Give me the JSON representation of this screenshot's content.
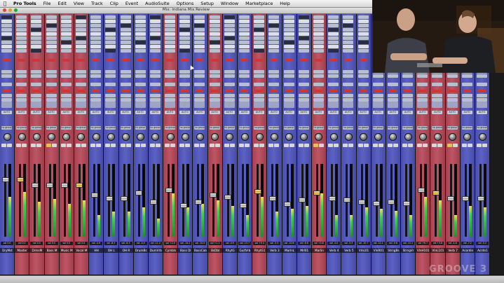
{
  "menubar": {
    "apple_icon": "apple-icon",
    "items": [
      "Pro Tools",
      "File",
      "Edit",
      "View",
      "Track",
      "Clip",
      "Event",
      "AudioSuite",
      "Options",
      "Setup",
      "Window",
      "Marketplace",
      "Help"
    ]
  },
  "window": {
    "title": "Mix: Indiana Mix Review"
  },
  "labels": {
    "auto": "AUTO",
    "group": "no group"
  },
  "tracks": [
    {
      "name": "DryMst",
      "vol": "vol  0.0",
      "color": "blue",
      "level": 0.55,
      "fader": 0.22
    },
    {
      "name": "Master",
      "vol": "vol  0.0",
      "color": "red",
      "level": 0.62,
      "fader": 0.22
    },
    {
      "name": "DrmsM",
      "vol": "vol  0.0",
      "color": "red",
      "level": 0.48,
      "fader": 0.3
    },
    {
      "name": "Bass M",
      "vol": "vol  0.0",
      "color": "red",
      "level": 0.52,
      "fader": 0.3
    },
    {
      "name": "Music M",
      "vol": "vol  0.0",
      "color": "red",
      "level": 0.45,
      "fader": 0.3
    },
    {
      "name": "Vocal M",
      "vol": "vol  0.0",
      "color": "red",
      "level": 0.5,
      "fader": 0.3
    },
    {
      "name": "HH",
      "vol": "vol -4.9",
      "color": "blue",
      "level": 0.3,
      "fader": 0.45
    },
    {
      "name": "OH L",
      "vol": "vol -8.3",
      "color": "blue",
      "level": 0.35,
      "fader": 0.5
    },
    {
      "name": "OH R",
      "vol": "vol -8.3",
      "color": "blue",
      "level": 0.35,
      "fader": 0.5
    },
    {
      "name": "DrumBs",
      "vol": "vol -4.0",
      "color": "blue",
      "level": 0.4,
      "fader": 0.42
    },
    {
      "name": "DumVrb",
      "vol": "vol -11.2",
      "color": "blue",
      "level": 0.25,
      "fader": 0.55
    },
    {
      "name": "Cymbls",
      "vol": "vol +2.0",
      "color": "red",
      "level": 0.6,
      "fader": 0.38
    },
    {
      "name": "Bass DI",
      "vol": "vol -14.2",
      "color": "blue",
      "level": 0.4,
      "fader": 0.6
    },
    {
      "name": "BassCab",
      "vol": "vol -10.5",
      "color": "blue",
      "level": 0.45,
      "fader": 0.55
    },
    {
      "name": "BsDbl",
      "vol": "vol +1.1",
      "color": "red",
      "level": 0.5,
      "fader": 0.45
    },
    {
      "name": "RhytG",
      "vol": "vol -4.9",
      "color": "blue",
      "level": 0.42,
      "fader": 0.48
    },
    {
      "name": "GuitVrb",
      "vol": "vol -13.7",
      "color": "blue",
      "level": 0.3,
      "fader": 0.6
    },
    {
      "name": "RhytG1",
      "vol": "vol +0.4",
      "color": "red",
      "level": 0.55,
      "fader": 0.4
    },
    {
      "name": "Verb 3",
      "vol": "vol -5.5",
      "color": "blue",
      "level": 0.35,
      "fader": 0.5
    },
    {
      "name": "MarlnL",
      "vol": "vol -10.6",
      "color": "blue",
      "level": 0.38,
      "fader": 0.58
    },
    {
      "name": "Mrl01",
      "vol": "vol -6.6",
      "color": "blue",
      "level": 0.42,
      "fader": 0.52
    },
    {
      "name": "Marlin",
      "vol": "vol +4.6",
      "color": "red",
      "level": 0.6,
      "fader": 0.42
    },
    {
      "name": "Verb 4",
      "vol": "vol -4.0",
      "color": "blue",
      "level": 0.3,
      "fader": 0.5
    },
    {
      "name": "Verb 5",
      "vol": "vol -5.3",
      "color": "blue",
      "level": 0.3,
      "fader": 0.52
    },
    {
      "name": "VlnL01",
      "vol": "vol -10.7",
      "color": "blue",
      "level": 0.4,
      "fader": 0.55
    },
    {
      "name": "VlnR01",
      "vol": "vol -12.1",
      "color": "blue",
      "level": 0.38,
      "fader": 0.57
    },
    {
      "name": "StrngBs",
      "vol": "vol -9.8",
      "color": "blue",
      "level": 0.36,
      "fader": 0.55
    },
    {
      "name": "StrngVr",
      "vol": "vol -11.1",
      "color": "blue",
      "level": 0.3,
      "fader": 0.57
    },
    {
      "name": "VlnH101",
      "vol": "vol +6.7",
      "color": "red",
      "level": 0.55,
      "fader": 0.38
    },
    {
      "name": "VlnL101",
      "vol": "vol +3.8",
      "color": "red",
      "level": 0.5,
      "fader": 0.42
    },
    {
      "name": "Verb 7",
      "vol": "vol -4.8",
      "color": "red",
      "level": 0.3,
      "fader": 0.5
    },
    {
      "name": "Acordin",
      "vol": "vol -7.2",
      "color": "blue",
      "level": 0.42,
      "fader": 0.5
    },
    {
      "name": "Acrdn1",
      "vol": "vol -5.2",
      "color": "blue",
      "level": 0.4,
      "fader": 0.5
    }
  ],
  "colors": {
    "blue": "#5a60c2",
    "red": "#b9505f",
    "purple": "#7a5fb4"
  },
  "watermark": "GROOVE 3"
}
